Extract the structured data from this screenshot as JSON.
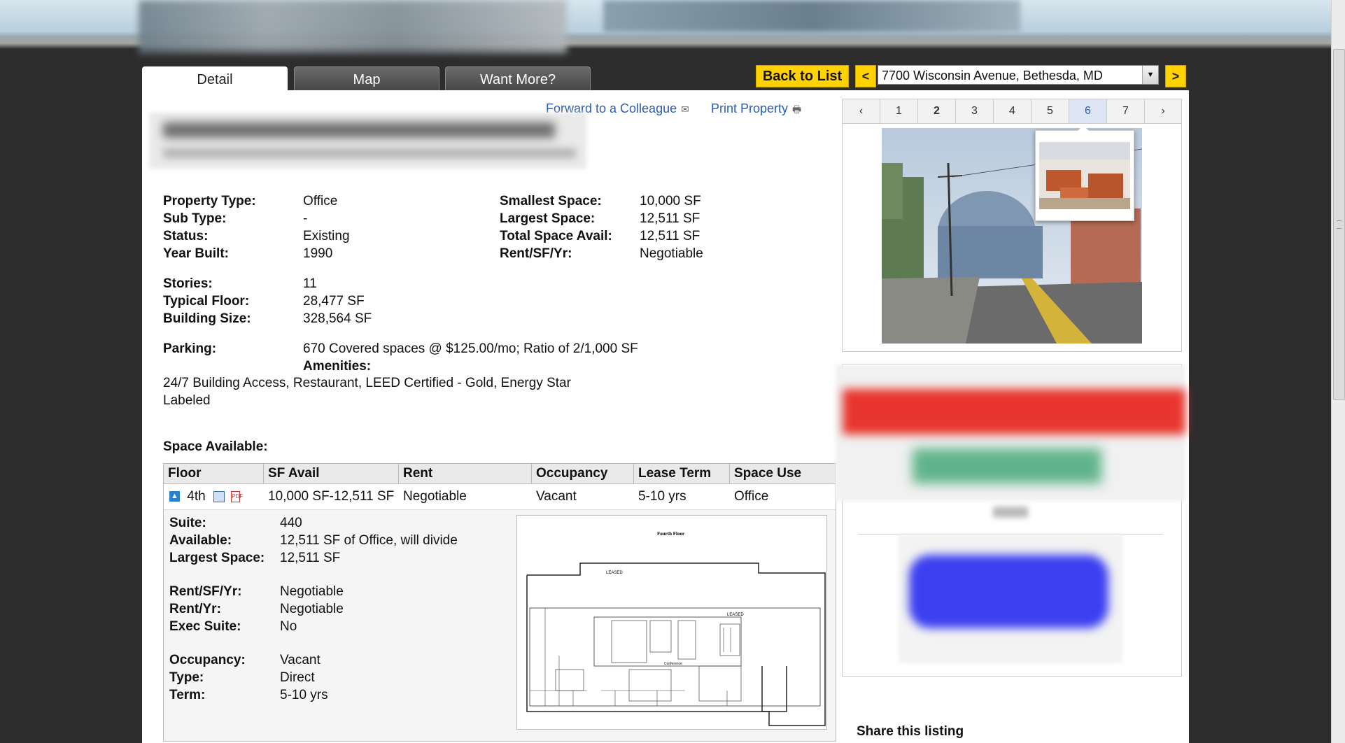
{
  "tabs": [
    {
      "label": "Detail",
      "active": true
    },
    {
      "label": "Map",
      "active": false
    },
    {
      "label": "Want More?",
      "active": false
    }
  ],
  "nav": {
    "back_label": "Back to List",
    "prev_arrow": "<",
    "next_arrow": ">",
    "address_selected": "7700 Wisconsin Avenue, Bethesda, MD"
  },
  "actions": {
    "forward": "Forward to a Colleague",
    "print": "Print Property"
  },
  "details_left": [
    {
      "label": "Property Type:",
      "value": "Office"
    },
    {
      "label": "Sub Type:",
      "value": "-"
    },
    {
      "label": "Status:",
      "value": "Existing"
    },
    {
      "label": "Year Built:",
      "value": "1990"
    }
  ],
  "details_right": [
    {
      "label": "Smallest Space:",
      "value": "10,000 SF"
    },
    {
      "label": "Largest Space:",
      "value": "12,511 SF"
    },
    {
      "label": "Total Space Avail:",
      "value": "12,511 SF"
    },
    {
      "label": "Rent/SF/Yr:",
      "value": "Negotiable"
    }
  ],
  "building": [
    {
      "label": "Stories:",
      "value": "11"
    },
    {
      "label": "Typical Floor:",
      "value": "28,477 SF"
    },
    {
      "label": "Building Size:",
      "value": "328,564 SF"
    }
  ],
  "parking": {
    "label": "Parking:",
    "value": "670 Covered spaces @ $125.00/mo; Ratio of 2/1,000 SF"
  },
  "amenities": {
    "label": "Amenities:",
    "line1": "24/7 Building Access, Restaurant, LEED Certified - Gold, Energy Star",
    "line2": "Labeled"
  },
  "space_available": {
    "heading": "Space Available:",
    "columns": [
      "Floor",
      "SF Avail",
      "Rent",
      "Occupancy",
      "Lease Term",
      "Space Use"
    ],
    "row": {
      "floor": "4th",
      "sf_avail": "10,000 SF-12,511 SF",
      "rent": "Negotiable",
      "occupancy": "Vacant",
      "lease_term": "5-10 yrs",
      "space_use": "Office"
    },
    "detail": [
      {
        "label": "Suite:",
        "value": "440"
      },
      {
        "label": "Available:",
        "value": "12,511 SF of Office, will divide"
      },
      {
        "label": "Largest Space:",
        "value": "12,511 SF"
      },
      {
        "label": "Rent/SF/Yr:",
        "value": "Negotiable"
      },
      {
        "label": "Rent/Yr:",
        "value": "Negotiable"
      },
      {
        "label": "Exec Suite:",
        "value": "No"
      },
      {
        "label": "Occupancy:",
        "value": "Vacant"
      },
      {
        "label": "Type:",
        "value": "Direct"
      },
      {
        "label": "Term:",
        "value": "5-10 yrs"
      }
    ],
    "floorplan": {
      "title": "Fourth Floor",
      "leased_1": "LEASED",
      "leased_2": "LEASED",
      "conference": "Conference"
    }
  },
  "gallery": {
    "pages": [
      "1",
      "2",
      "3",
      "4",
      "5",
      "6",
      "7"
    ],
    "current_page": "6",
    "prev": "‹",
    "next": "›"
  },
  "share": {
    "heading": "Share this listing"
  },
  "icons": [
    "envelope-icon",
    "printer-icon",
    "expand-icon",
    "floorplan-icon",
    "pdf-icon"
  ],
  "colors": {
    "accent_yellow": "#ffd200",
    "link_blue": "#2a5db0",
    "background": "#2d2d2d"
  }
}
